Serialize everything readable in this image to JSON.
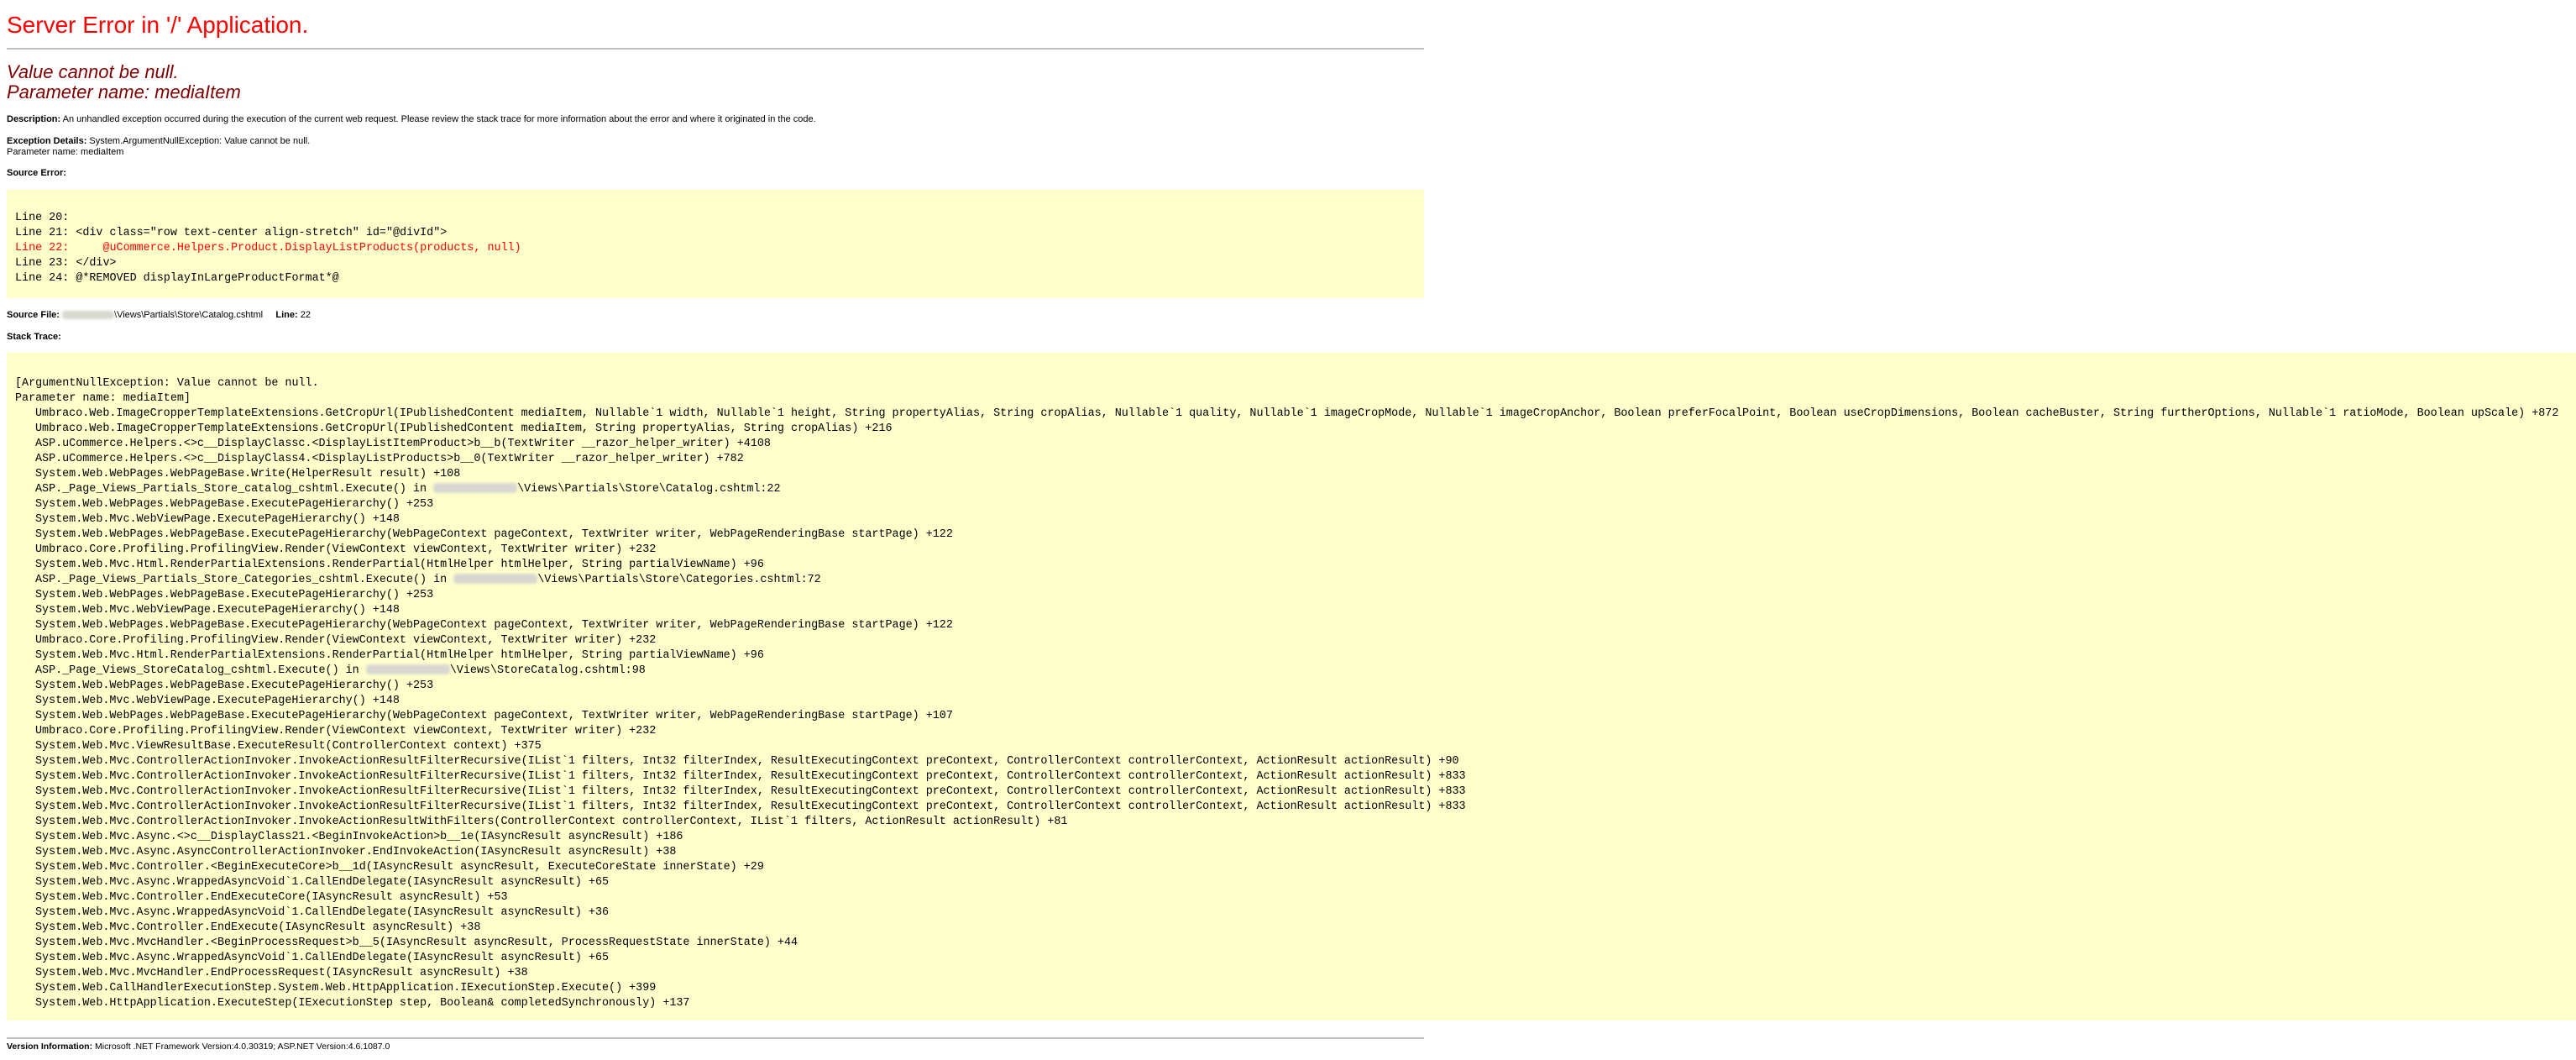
{
  "title": "Server Error in '/' Application.",
  "exception": {
    "message": "Value cannot be null.",
    "parameter": "Parameter name: mediaItem"
  },
  "description": {
    "label": "Description:",
    "text": "An unhandled exception occurred during the execution of the current web request. Please review the stack trace for more information about the error and where it originated in the code."
  },
  "exception_details": {
    "label": "Exception Details:",
    "line1": "System.ArgumentNullException: Value cannot be null.",
    "line2": "Parameter name: mediaItem"
  },
  "source_error": {
    "label": "Source Error:",
    "lines": [
      "Line 20:",
      "Line 21: <div class=\"row text-center align-stretch\" id=\"@divId\">",
      "Line 22:     @uCommerce.Helpers.Product.DisplayListProducts(products, null)",
      "Line 23: </div>",
      "Line 24: @*REMOVED displayInLargeProductFormat*@"
    ],
    "highlight_index": 2
  },
  "source_file": {
    "label": "Source File:",
    "path_suffix": "\\Views\\Partials\\Store\\Catalog.cshtml",
    "line_label": "Line:",
    "line_number": "22"
  },
  "stack_trace": {
    "label": "Stack Trace:",
    "header": [
      "[ArgumentNullException: Value cannot be null.",
      "Parameter name: mediaItem]"
    ],
    "frames": [
      {
        "pre": "Umbraco.Web.ImageCropperTemplateExtensions.GetCropUrl(IPublishedContent mediaItem, Nullable`1 width, Nullable`1 height, String propertyAlias, String cropAlias, Nullable`1 quality, Nullable`1 imageCropMode, Nullable`1 imageCropAnchor, Boolean preferFocalPoint, Boolean useCropDimensions, Boolean cacheBuster, String furtherOptions, Nullable`1 ratioMode, Boolean upScale) +872"
      },
      {
        "pre": "Umbraco.Web.ImageCropperTemplateExtensions.GetCropUrl(IPublishedContent mediaItem, String propertyAlias, String cropAlias) +216"
      },
      {
        "pre": "ASP.uCommerce.Helpers.<>c__DisplayClassc.<DisplayListItemProduct>b__b(TextWriter __razor_helper_writer) +4108"
      },
      {
        "pre": "ASP.uCommerce.Helpers.<>c__DisplayClass4.<DisplayListProducts>b__0(TextWriter __razor_helper_writer) +782"
      },
      {
        "pre": "System.Web.WebPages.WebPageBase.Write(HelperResult result) +108"
      },
      {
        "pre": "ASP._Page_Views_Partials_Store_catalog_cshtml.Execute() in ",
        "blur": 100,
        "post": "\\Views\\Partials\\Store\\Catalog.cshtml:22"
      },
      {
        "pre": "System.Web.WebPages.WebPageBase.ExecutePageHierarchy() +253"
      },
      {
        "pre": "System.Web.Mvc.WebViewPage.ExecutePageHierarchy() +148"
      },
      {
        "pre": "System.Web.WebPages.WebPageBase.ExecutePageHierarchy(WebPageContext pageContext, TextWriter writer, WebPageRenderingBase startPage) +122"
      },
      {
        "pre": "Umbraco.Core.Profiling.ProfilingView.Render(ViewContext viewContext, TextWriter writer) +232"
      },
      {
        "pre": "System.Web.Mvc.Html.RenderPartialExtensions.RenderPartial(HtmlHelper htmlHelper, String partialViewName) +96"
      },
      {
        "pre": "ASP._Page_Views_Partials_Store_Categories_cshtml.Execute() in ",
        "blur": 100,
        "post": "\\Views\\Partials\\Store\\Categories.cshtml:72"
      },
      {
        "pre": "System.Web.WebPages.WebPageBase.ExecutePageHierarchy() +253"
      },
      {
        "pre": "System.Web.Mvc.WebViewPage.ExecutePageHierarchy() +148"
      },
      {
        "pre": "System.Web.WebPages.WebPageBase.ExecutePageHierarchy(WebPageContext pageContext, TextWriter writer, WebPageRenderingBase startPage) +122"
      },
      {
        "pre": "Umbraco.Core.Profiling.ProfilingView.Render(ViewContext viewContext, TextWriter writer) +232"
      },
      {
        "pre": "System.Web.Mvc.Html.RenderPartialExtensions.RenderPartial(HtmlHelper htmlHelper, String partialViewName) +96"
      },
      {
        "pre": "ASP._Page_Views_StoreCatalog_cshtml.Execute() in ",
        "blur": 100,
        "post": "\\Views\\StoreCatalog.cshtml:98"
      },
      {
        "pre": "System.Web.WebPages.WebPageBase.ExecutePageHierarchy() +253"
      },
      {
        "pre": "System.Web.Mvc.WebViewPage.ExecutePageHierarchy() +148"
      },
      {
        "pre": "System.Web.WebPages.WebPageBase.ExecutePageHierarchy(WebPageContext pageContext, TextWriter writer, WebPageRenderingBase startPage) +107"
      },
      {
        "pre": "Umbraco.Core.Profiling.ProfilingView.Render(ViewContext viewContext, TextWriter writer) +232"
      },
      {
        "pre": "System.Web.Mvc.ViewResultBase.ExecuteResult(ControllerContext context) +375"
      },
      {
        "pre": "System.Web.Mvc.ControllerActionInvoker.InvokeActionResultFilterRecursive(IList`1 filters, Int32 filterIndex, ResultExecutingContext preContext, ControllerContext controllerContext, ActionResult actionResult) +90"
      },
      {
        "pre": "System.Web.Mvc.ControllerActionInvoker.InvokeActionResultFilterRecursive(IList`1 filters, Int32 filterIndex, ResultExecutingContext preContext, ControllerContext controllerContext, ActionResult actionResult) +833"
      },
      {
        "pre": "System.Web.Mvc.ControllerActionInvoker.InvokeActionResultFilterRecursive(IList`1 filters, Int32 filterIndex, ResultExecutingContext preContext, ControllerContext controllerContext, ActionResult actionResult) +833"
      },
      {
        "pre": "System.Web.Mvc.ControllerActionInvoker.InvokeActionResultFilterRecursive(IList`1 filters, Int32 filterIndex, ResultExecutingContext preContext, ControllerContext controllerContext, ActionResult actionResult) +833"
      },
      {
        "pre": "System.Web.Mvc.ControllerActionInvoker.InvokeActionResultWithFilters(ControllerContext controllerContext, IList`1 filters, ActionResult actionResult) +81"
      },
      {
        "pre": "System.Web.Mvc.Async.<>c__DisplayClass21.<BeginInvokeAction>b__1e(IAsyncResult asyncResult) +186"
      },
      {
        "pre": "System.Web.Mvc.Async.AsyncControllerActionInvoker.EndInvokeAction(IAsyncResult asyncResult) +38"
      },
      {
        "pre": "System.Web.Mvc.Controller.<BeginExecuteCore>b__1d(IAsyncResult asyncResult, ExecuteCoreState innerState) +29"
      },
      {
        "pre": "System.Web.Mvc.Async.WrappedAsyncVoid`1.CallEndDelegate(IAsyncResult asyncResult) +65"
      },
      {
        "pre": "System.Web.Mvc.Controller.EndExecuteCore(IAsyncResult asyncResult) +53"
      },
      {
        "pre": "System.Web.Mvc.Async.WrappedAsyncVoid`1.CallEndDelegate(IAsyncResult asyncResult) +36"
      },
      {
        "pre": "System.Web.Mvc.Controller.EndExecute(IAsyncResult asyncResult) +38"
      },
      {
        "pre": "System.Web.Mvc.MvcHandler.<BeginProcessRequest>b__5(IAsyncResult asyncResult, ProcessRequestState innerState) +44"
      },
      {
        "pre": "System.Web.Mvc.Async.WrappedAsyncVoid`1.CallEndDelegate(IAsyncResult asyncResult) +65"
      },
      {
        "pre": "System.Web.Mvc.MvcHandler.EndProcessRequest(IAsyncResult asyncResult) +38"
      },
      {
        "pre": "System.Web.CallHandlerExecutionStep.System.Web.HttpApplication.IExecutionStep.Execute() +399"
      },
      {
        "pre": "System.Web.HttpApplication.ExecuteStep(IExecutionStep step, Boolean& completedSynchronously) +137"
      }
    ]
  },
  "version": {
    "label": "Version Information:",
    "text": "Microsoft .NET Framework Version:4.0.30319; ASP.NET Version:4.6.1087.0"
  },
  "colors": {
    "title_red": "#ff0000",
    "exception_maroon": "#800000",
    "code_background": "#ffffcc",
    "rule_gray": "#c0c0c0"
  }
}
